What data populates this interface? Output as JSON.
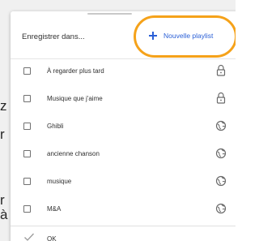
{
  "background": {
    "fragments": [
      "z",
      "r",
      "r",
      "à"
    ]
  },
  "dialog": {
    "title": "Enregistrer dans...",
    "new_playlist": {
      "label": "Nouvelle playlist",
      "icon": "plus-icon",
      "highlight_color": "#f5a21a",
      "text_color": "#2a5fd6"
    },
    "playlists": [
      {
        "label": "À regarder plus tard",
        "checked": false,
        "icon": "lock-icon"
      },
      {
        "label": "Musique que j'aime",
        "checked": false,
        "icon": "lock-icon"
      },
      {
        "label": "Ghibli",
        "checked": false,
        "icon": "globe-icon"
      },
      {
        "label": "ancienne chanson",
        "checked": false,
        "icon": "globe-icon"
      },
      {
        "label": "musique",
        "checked": false,
        "icon": "globe-icon"
      },
      {
        "label": "M&A",
        "checked": false,
        "icon": "globe-icon"
      }
    ],
    "confirm": {
      "label": "OK",
      "icon": "check-icon"
    }
  }
}
